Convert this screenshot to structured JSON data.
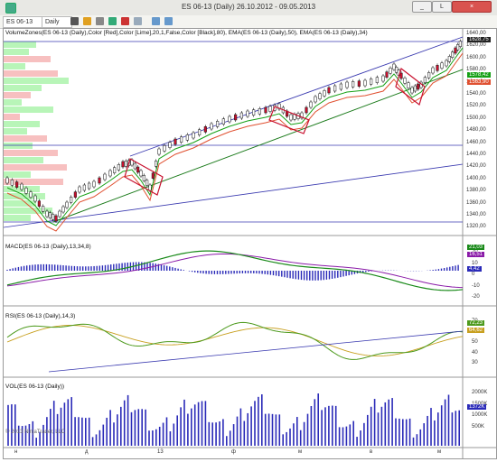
{
  "window": {
    "title": "ES 06-13 (Daily)  26.10.2012 - 09.05.2013",
    "min_label": "_",
    "max_label": "L",
    "close_label": "×"
  },
  "toolbar": {
    "instrument": "ES 06-13",
    "period": "Daily"
  },
  "price_panel": {
    "indicator_label": "VolumeZones(ES 06-13 (Daily),Color [Red],Color [Lime],20,1,False,Color [Black],80), EMA(ES 06-13 (Daily),50), EMA(ES 06-13 (Daily),34)",
    "axis_ticks": [
      "1640,00",
      "1620,00",
      "1600,00",
      "1580,00",
      "1560,00",
      "1540,00",
      "1520,00",
      "1500,00",
      "1480,00",
      "1460,00",
      "1440,00",
      "1420,00",
      "1400,00",
      "1380,00",
      "1360,00",
      "1340,00",
      "1320,00"
    ],
    "last_price": "1628,75",
    "ema_fast": "1578,42",
    "ema_slow": "1563,90"
  },
  "macd_panel": {
    "label": "MACD(ES 06-13 (Daily),13,34,8)",
    "axis_ticks": [
      "20",
      "10",
      "0",
      "-10",
      "-20"
    ],
    "macd_value": "21,03",
    "signal_value": "16,51",
    "hist_value": "4,42"
  },
  "rsi_panel": {
    "label": "RSI(ES 06-13 (Daily),14,3)",
    "axis_ticks": [
      "70",
      "60",
      "50",
      "40",
      "30"
    ],
    "rsi_value": "72,23",
    "avg_value": "64,62"
  },
  "vol_panel": {
    "label": "VOL(ES 06-13 (Daily))",
    "axis_ticks": [
      "2000K",
      "1500K",
      "1000K",
      "500K"
    ],
    "vol_value": "1372K"
  },
  "x_axis": {
    "labels": [
      "н",
      "д",
      "13",
      "ф",
      "м",
      "в",
      "м"
    ]
  },
  "copyright": "© 2013 NinjaTrader, LLC",
  "colors": {
    "up_candle": "#ffffff",
    "down_candle": "#c8102e",
    "ema_fast": "#15a015",
    "ema_slow": "#e05030",
    "trend": "#1a7a1a",
    "channel": "#3a3ab0",
    "macd": "#1a8a1a",
    "macd_signal": "#8a1aa8",
    "rsi": "#4d9a1d",
    "rsi_avg": "#c8a020",
    "volume": "#2a2ab8",
    "zone_buy": "#b8f5b8",
    "zone_sell": "#f7c0c0"
  }
}
